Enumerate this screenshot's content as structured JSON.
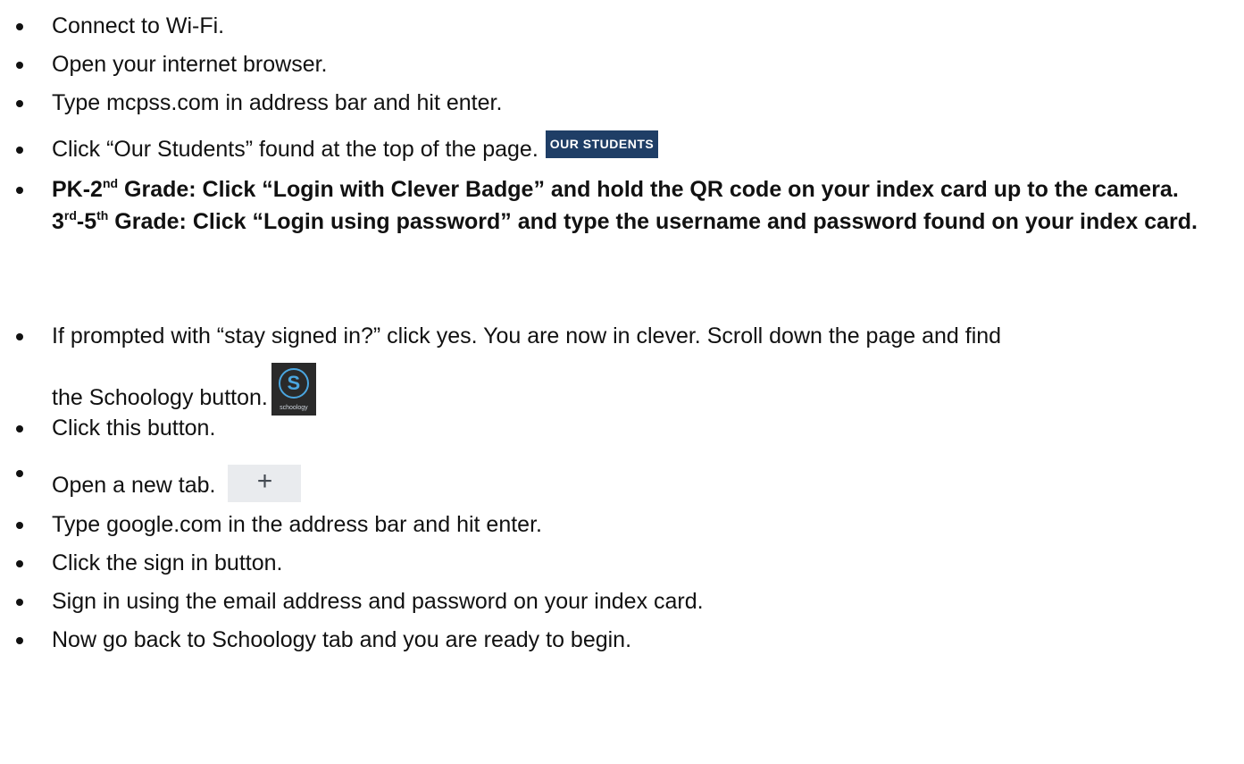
{
  "steps": {
    "s1": "Connect to Wi-Fi.",
    "s2": "Open your internet browser.",
    "s3": "Type mcpss.com in address bar and hit enter.",
    "s4": "Click “Our Students” found at the top of the page.",
    "s4_button": "OUR STUDENTS",
    "s5_grade_a_num": "PK-2",
    "s5_grade_a_sup": "nd",
    "s5_grade_a_text": " Grade: Click “Login with Clever Badge” and hold the QR code on your index card up to the camera.",
    "s5_grade_b_num1": "3",
    "s5_grade_b_sup1": "rd",
    "s5_grade_b_mid": "-5",
    "s5_grade_b_sup2": "th",
    "s5_grade_b_text": " Grade: Click “Login using password” and type the username and password found on your index card.",
    "s6_line1": "If prompted with “stay signed in?” click yes. You are now in clever. Scroll down the page and find",
    "s6_line2": "the Schoology button.",
    "s6_icon_letter": "S",
    "s6_icon_word": "schoology",
    "s7": "Click this button.",
    "s8": "Open a new tab.",
    "s8_icon": "+",
    "s9": "Type google.com in the address bar and hit enter.",
    "s10": "Click the sign in button.",
    "s11": "Sign in using the email address and password on your index card.",
    "s12": "Now go back to Schoology tab and you are ready to begin."
  },
  "colors": {
    "our_students_bg": "#1f3e66",
    "schoology_bg": "#2a2a2a",
    "schoology_accent": "#4aa6e0",
    "new_tab_bg": "#e9ebee"
  },
  "icons": {
    "schoology": "schoology-app-icon",
    "new_tab": "plus-icon"
  }
}
